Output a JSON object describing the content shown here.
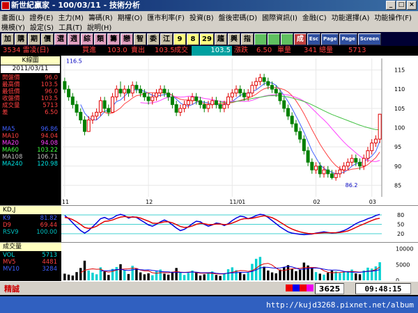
{
  "window": {
    "title": "新世紀贏家 - 100/03/11 - 技術分析",
    "buttons": [
      "_",
      "□",
      "×"
    ]
  },
  "menu": {
    "row1": [
      "畫面(L)",
      "證券(E)",
      "主力(M)",
      "籌碼(R)",
      "期權(O)",
      "匯市利率(F)",
      "投資(B)",
      "盤後密碼(D)",
      "國際資訊(I)",
      "金融(C)",
      "功能選擇(A)",
      "功能操作(F)"
    ],
    "row2": [
      "機模(Y)",
      "設定(S)",
      "工具(T)",
      "說明(H)"
    ]
  },
  "toolbar": {
    "buttons": [
      "加",
      "購",
      "期",
      "價",
      "選",
      "週",
      "綜",
      "類",
      "籌",
      "戀",
      "智",
      "委",
      "江",
      "9",
      "8",
      "29",
      "趨",
      "興",
      "指",
      "",
      "",
      "",
      "成",
      "Esc",
      "Page",
      "Page",
      "Screen"
    ]
  },
  "info": {
    "stock": "3534 雷凌(日)",
    "buy_label": "買進",
    "buy_val": "103.0",
    "sell_label": "賣出",
    "sell_val": "103.5",
    "deal_label": "成交",
    "deal_val": "103.5",
    "change_label": "漲跌",
    "change_val": "6.50",
    "vol_label": "單量",
    "vol_val": "341",
    "total_label": "總量",
    "total_val": "5713"
  },
  "kpanel": {
    "title": "K線圖",
    "date": "2011/03/11",
    "rows": [
      {
        "label": "開盤價",
        "value": "96.0",
        "color": "#ff4040"
      },
      {
        "label": "最高價",
        "value": "103.5",
        "color": "#ff4040"
      },
      {
        "label": "最低價",
        "value": "96.0",
        "color": "#ff4040"
      },
      {
        "label": "收盤價",
        "value": "103.5",
        "color": "#ff4040"
      },
      {
        "label": "成交量",
        "value": "5713",
        "color": "#ff4040"
      },
      {
        "label": "差",
        "value": "6.50",
        "color": "#ff4040"
      }
    ],
    "ma": [
      {
        "label": "MA5",
        "value": "96.86",
        "color": "#4060ff"
      },
      {
        "label": "MA10",
        "value": "94.04",
        "color": "#ff4040"
      },
      {
        "label": "MA20",
        "value": "94.08",
        "color": "#ff40ff"
      },
      {
        "label": "MA60",
        "value": "103.22",
        "color": "#40ff40"
      },
      {
        "label": "MA108",
        "value": "106.71",
        "color": "#c0c0c0"
      },
      {
        "label": "MA240",
        "value": "120.98",
        "color": "#00e0e0"
      }
    ]
  },
  "kd": {
    "title": "KD,J",
    "rows": [
      {
        "label": "K9",
        "value": "81.82",
        "color": "#4060ff"
      },
      {
        "label": "D9",
        "value": "69.44",
        "color": "#ff4040"
      },
      {
        "label": "RSV9",
        "value": "100.00",
        "color": "#00c0c0"
      }
    ],
    "ticks": [
      "80",
      "50",
      "20"
    ]
  },
  "volume": {
    "title": "成交量",
    "rows": [
      {
        "label": "VOL",
        "value": "5713",
        "color": "#00e0e0"
      },
      {
        "label": "MV5",
        "value": "4481",
        "color": "#ff4040"
      },
      {
        "label": "MV10",
        "value": "3284",
        "color": "#4060ff"
      }
    ],
    "ticks": [
      "10000",
      "5000",
      "0"
    ]
  },
  "status": {
    "left": "精誠",
    "code": "3625",
    "time": "09:48:15"
  },
  "watermark": "http://kujd3268.pixnet.net/album",
  "chart_data": {
    "type": "candlestick",
    "title": "3534 雷凌(日)",
    "ylim": [
      82,
      118
    ],
    "yticks": [
      85,
      90,
      95,
      100,
      105,
      110,
      115
    ],
    "xticks": [
      {
        "label": "11",
        "i": 0
      },
      {
        "label": "12",
        "i": 21
      },
      {
        "label": "11/01",
        "i": 42
      },
      {
        "label": "02",
        "i": 63
      },
      {
        "label": "03",
        "i": 77
      }
    ],
    "annotations": [
      {
        "text": "116.5",
        "i": 0,
        "price": 116.5
      },
      {
        "text": "86.2",
        "i": 70,
        "price": 86.2
      }
    ],
    "candles": [
      [
        112,
        113,
        109,
        110
      ],
      [
        110,
        111,
        107,
        108
      ],
      [
        108,
        109,
        105,
        106
      ],
      [
        106,
        107,
        103,
        104
      ],
      [
        104,
        105,
        101,
        102
      ],
      [
        102,
        103,
        98,
        99
      ],
      [
        99,
        103,
        99,
        102
      ],
      [
        102,
        104,
        101,
        103
      ],
      [
        103,
        105,
        102,
        104
      ],
      [
        104,
        108,
        103,
        107
      ],
      [
        107,
        108,
        104,
        105
      ],
      [
        105,
        106,
        103,
        104
      ],
      [
        104,
        109,
        104,
        108
      ],
      [
        108,
        111,
        107,
        110
      ],
      [
        110,
        112,
        108,
        109
      ],
      [
        109,
        111,
        107,
        110
      ],
      [
        110,
        111,
        108,
        109
      ],
      [
        109,
        112,
        108,
        111
      ],
      [
        111,
        112,
        109,
        110
      ],
      [
        110,
        111,
        108,
        109
      ],
      [
        109,
        110,
        107,
        108
      ],
      [
        108,
        109,
        106,
        107
      ],
      [
        107,
        109,
        106,
        108
      ],
      [
        108,
        110,
        107,
        109
      ],
      [
        109,
        111,
        108,
        110
      ],
      [
        110,
        111,
        108,
        109
      ],
      [
        109,
        110,
        107,
        108
      ],
      [
        108,
        109,
        105,
        106
      ],
      [
        106,
        107,
        103,
        104
      ],
      [
        104,
        106,
        103,
        105
      ],
      [
        105,
        107,
        104,
        106
      ],
      [
        106,
        108,
        105,
        107
      ],
      [
        107,
        109,
        106,
        108
      ],
      [
        108,
        109,
        106,
        107
      ],
      [
        107,
        108,
        105,
        106
      ],
      [
        106,
        107,
        104,
        105
      ],
      [
        105,
        107,
        104,
        106
      ],
      [
        106,
        108,
        105,
        107
      ],
      [
        107,
        108,
        105,
        106
      ],
      [
        106,
        107,
        104,
        105
      ],
      [
        105,
        107,
        104,
        106
      ],
      [
        106,
        109,
        105,
        108
      ],
      [
        108,
        110,
        107,
        109
      ],
      [
        109,
        111,
        108,
        110
      ],
      [
        110,
        111,
        108,
        109
      ],
      [
        109,
        110,
        107,
        108
      ],
      [
        108,
        110,
        107,
        109
      ],
      [
        109,
        112,
        108,
        111
      ],
      [
        111,
        113,
        110,
        112
      ],
      [
        112,
        114,
        111,
        113
      ],
      [
        113,
        114,
        111,
        112
      ],
      [
        112,
        113,
        110,
        111
      ],
      [
        111,
        112,
        109,
        110
      ],
      [
        110,
        111,
        108,
        109
      ],
      [
        109,
        110,
        106,
        107
      ],
      [
        107,
        108,
        104,
        105
      ],
      [
        105,
        106,
        102,
        103
      ],
      [
        103,
        104,
        100,
        101
      ],
      [
        101,
        102,
        98,
        99
      ],
      [
        99,
        100,
        96,
        97
      ],
      [
        97,
        98,
        93,
        94
      ],
      [
        94,
        95,
        90,
        91
      ],
      [
        91,
        92,
        88,
        89
      ],
      [
        89,
        91,
        88,
        90
      ],
      [
        90,
        91,
        87,
        88
      ],
      [
        88,
        90,
        87,
        89
      ],
      [
        89,
        90,
        87,
        88
      ],
      [
        88,
        89,
        86.5,
        87
      ],
      [
        87,
        89,
        86.2,
        88
      ],
      [
        88,
        90,
        87,
        89
      ],
      [
        89,
        91,
        88,
        90
      ],
      [
        90,
        92,
        89,
        91
      ],
      [
        91,
        93,
        90,
        92
      ],
      [
        92,
        93,
        90,
        91
      ],
      [
        91,
        92,
        89,
        90
      ],
      [
        90,
        93,
        89,
        92
      ],
      [
        92,
        95,
        91,
        94
      ],
      [
        94,
        97,
        93,
        96
      ],
      [
        96,
        98,
        95,
        97
      ],
      [
        97,
        103.5,
        96,
        103.5
      ]
    ],
    "volumes": [
      2100,
      1800,
      1500,
      2600,
      3900,
      6200,
      3100,
      2400,
      1900,
      4100,
      2800,
      1700,
      3600,
      4200,
      5100,
      3300,
      2000,
      4600,
      3800,
      2500,
      1900,
      2200,
      1600,
      2900,
      3400,
      2100,
      1800,
      2700,
      3900,
      2400,
      1700,
      2300,
      3100,
      2600,
      1500,
      1900,
      2200,
      2800,
      1700,
      1400,
      2000,
      3500,
      4100,
      3200,
      2600,
      1900,
      2400,
      5200,
      6800,
      7400,
      4300,
      3100,
      2500,
      2200,
      3400,
      4200,
      4800,
      3600,
      2900,
      3300,
      5600,
      4700,
      3900,
      2600,
      2100,
      1800,
      2400,
      3100,
      2800,
      2300,
      2600,
      2900,
      3400,
      2200,
      1900,
      3100,
      4000,
      3700,
      4400,
      5713
    ],
    "kd": {
      "k": [
        78,
        68,
        55,
        42,
        30,
        22,
        30,
        42,
        55,
        68,
        72,
        66,
        70,
        78,
        82,
        78,
        70,
        74,
        72,
        64,
        56,
        48,
        44,
        50,
        58,
        64,
        58,
        48,
        38,
        30,
        34,
        42,
        52,
        60,
        58,
        50,
        44,
        48,
        54,
        52,
        46,
        52,
        62,
        70,
        76,
        74,
        68,
        72,
        78,
        82,
        80,
        72,
        62,
        52,
        42,
        34,
        26,
        22,
        20,
        18,
        17,
        18,
        19,
        22,
        24,
        26,
        24,
        22,
        23,
        26,
        30,
        36,
        44,
        52,
        58,
        62,
        68,
        72,
        78,
        81.82
      ],
      "d": [
        72,
        70,
        65,
        58,
        49,
        40,
        37,
        39,
        44,
        52,
        59,
        61,
        64,
        69,
        73,
        75,
        73,
        73,
        73,
        70,
        65,
        60,
        54,
        53,
        55,
        58,
        58,
        55,
        49,
        43,
        40,
        41,
        45,
        50,
        53,
        52,
        49,
        49,
        51,
        51,
        49,
        50,
        54,
        59,
        65,
        68,
        68,
        69,
        72,
        75,
        77,
        75,
        71,
        65,
        57,
        49,
        41,
        35,
        30,
        26,
        23,
        21,
        20,
        21,
        22,
        23,
        23,
        23,
        23,
        24,
        26,
        29,
        34,
        40,
        46,
        51,
        57,
        62,
        67,
        69.44
      ]
    }
  }
}
